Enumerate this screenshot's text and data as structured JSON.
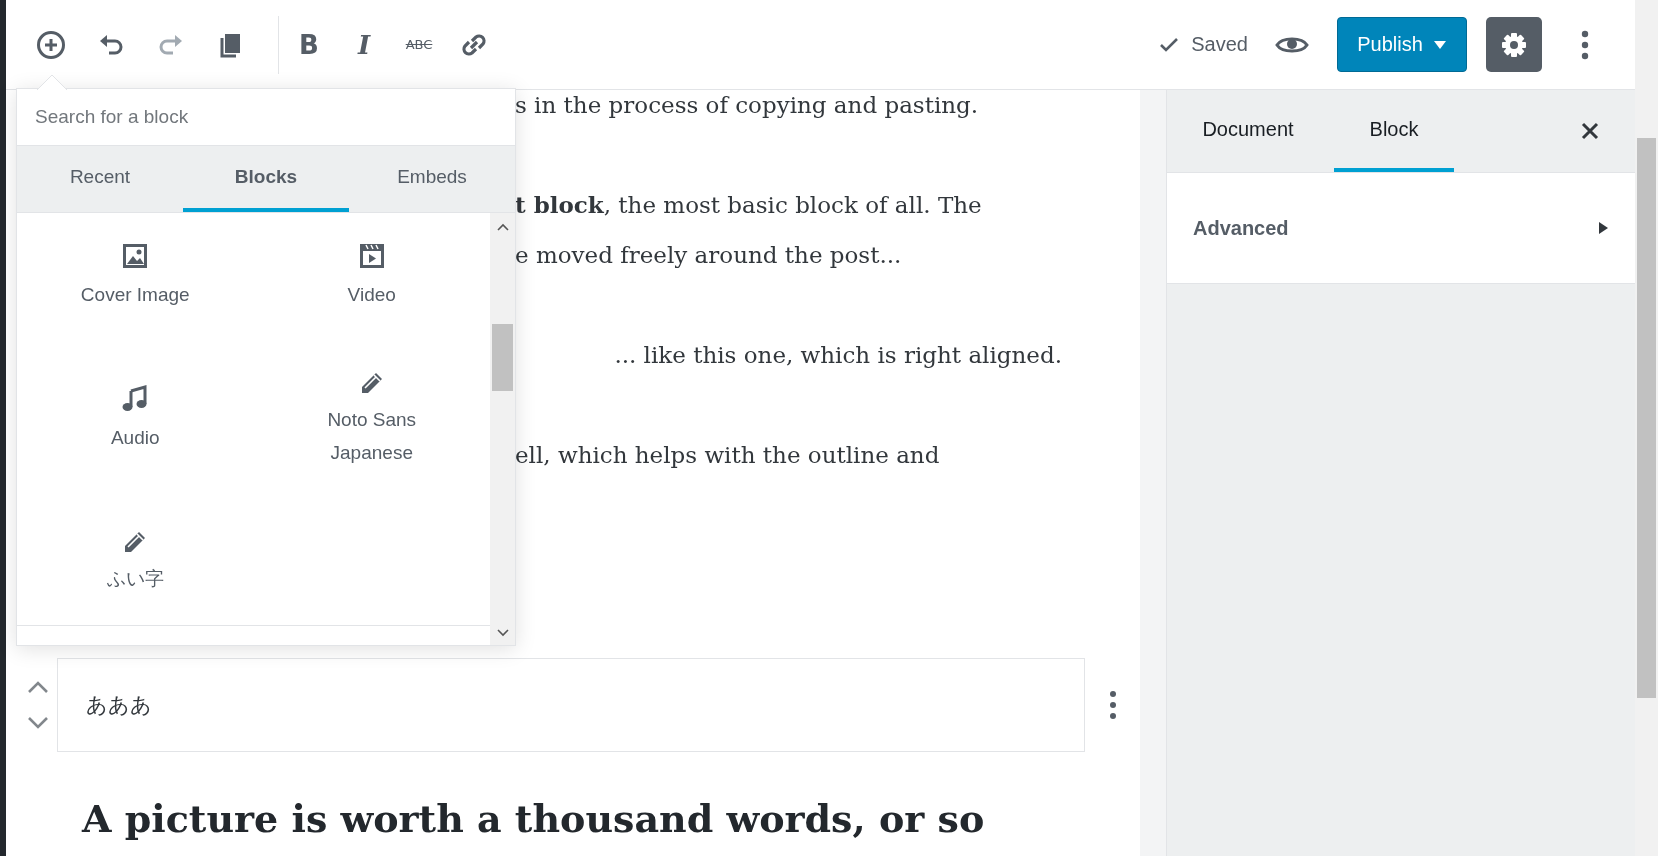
{
  "toolbar": {
    "history_tools": [
      {
        "kind": "add",
        "disabled": false
      },
      {
        "kind": "undo",
        "disabled": false
      },
      {
        "kind": "redo",
        "disabled": true
      },
      {
        "kind": "copy",
        "disabled": false
      }
    ],
    "format_tools": [
      {
        "kind": "bold",
        "glyph": "B"
      },
      {
        "kind": "italic",
        "glyph": "I"
      },
      {
        "kind": "strikethrough",
        "glyph": "ABC"
      },
      {
        "kind": "link"
      }
    ],
    "save_status": "Saved",
    "publish_button": "Publish",
    "settings_button": {
      "pressed": true
    }
  },
  "inserter": {
    "search": {
      "placeholder": "Search for a block"
    },
    "tabs": [
      {
        "label": "Recent",
        "selected": false
      },
      {
        "label": "Blocks",
        "selected": true
      },
      {
        "label": "Embeds",
        "selected": false
      }
    ],
    "blocks": [
      {
        "label": "Cover Image",
        "kind": "image"
      },
      {
        "label": "Video",
        "kind": "video"
      },
      {
        "label": "Audio",
        "kind": "audio"
      },
      {
        "label": "Noto Sans Japanese",
        "kind": "pencil"
      },
      {
        "label": "ふい字",
        "kind": "pencil"
      }
    ]
  },
  "editor": {
    "paragraphs": [
      {
        "kind": "plain",
        "lines": [
          "s in the process of copying and pasting."
        ]
      },
      {
        "kind": "plain",
        "lines": [
          "**t block**, the most basic block of all. The",
          "e moved freely around the post..."
        ]
      },
      {
        "kind": "right-aligned",
        "lines": [
          "... like this one, which is right aligned."
        ]
      },
      {
        "kind": "plain",
        "lines": [
          "ell, which helps with the outline and"
        ]
      }
    ],
    "selected_block": {
      "text": "あああ"
    },
    "heading": "A picture is worth a thousand words, or so"
  },
  "sidebar": {
    "tabs": [
      {
        "label": "Document",
        "selected": false
      },
      {
        "label": "Block",
        "selected": true
      }
    ],
    "panels": [
      {
        "title": "Advanced",
        "expanded": false
      }
    ]
  }
}
